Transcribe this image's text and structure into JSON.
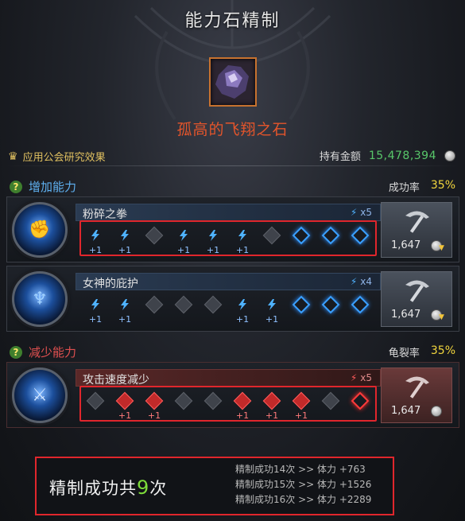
{
  "title": "能力石精制",
  "stone": {
    "name": "孤高的飞翔之石",
    "icon": "amethyst-stone-icon"
  },
  "guild": {
    "label": "应用公会研究效果"
  },
  "gold": {
    "label": "持有金额",
    "value": "15,478,394"
  },
  "increase": {
    "header": "增加能力",
    "rate_label": "成功率",
    "rate_value": "35%",
    "abilities": [
      {
        "name": "粉碎之拳",
        "mult": "x5",
        "slots": [
          {
            "state": "hit",
            "plus": "+1"
          },
          {
            "state": "hit",
            "plus": "+1"
          },
          {
            "state": "fail",
            "plus": ""
          },
          {
            "state": "hit",
            "plus": "+1"
          },
          {
            "state": "hit",
            "plus": "+1"
          },
          {
            "state": "hit",
            "plus": "+1"
          },
          {
            "state": "fail",
            "plus": ""
          },
          {
            "state": "empty",
            "plus": ""
          },
          {
            "state": "empty",
            "plus": ""
          },
          {
            "state": "empty",
            "plus": ""
          }
        ],
        "cost": "1,647"
      },
      {
        "name": "女神的庇护",
        "mult": "x4",
        "slots": [
          {
            "state": "hit",
            "plus": "+1"
          },
          {
            "state": "hit",
            "plus": "+1"
          },
          {
            "state": "fail",
            "plus": ""
          },
          {
            "state": "fail",
            "plus": ""
          },
          {
            "state": "fail",
            "plus": ""
          },
          {
            "state": "hit",
            "plus": "+1"
          },
          {
            "state": "hit",
            "plus": "+1"
          },
          {
            "state": "empty",
            "plus": ""
          },
          {
            "state": "empty",
            "plus": ""
          },
          {
            "state": "empty",
            "plus": ""
          }
        ],
        "cost": "1,647"
      }
    ]
  },
  "decrease": {
    "header": "减少能力",
    "rate_label": "龟裂率",
    "rate_value": "35%",
    "ability": {
      "name": "攻击速度减少",
      "mult": "x5",
      "slots": [
        {
          "state": "fail",
          "plus": ""
        },
        {
          "state": "hit",
          "plus": "+1"
        },
        {
          "state": "hit",
          "plus": "+1"
        },
        {
          "state": "fail",
          "plus": ""
        },
        {
          "state": "fail",
          "plus": ""
        },
        {
          "state": "hit",
          "plus": "+1"
        },
        {
          "state": "hit",
          "plus": "+1"
        },
        {
          "state": "hit",
          "plus": "+1"
        },
        {
          "state": "fail",
          "plus": ""
        },
        {
          "state": "empty",
          "plus": ""
        }
      ],
      "cost": "1,647"
    }
  },
  "result": {
    "prefix": "精制成功共",
    "count": "9",
    "suffix": "次",
    "lines": [
      "精制成功14次 >> 体力 +763",
      "精制成功15次 >> 体力 +1526",
      "精制成功16次 >> 体力 +2289"
    ]
  },
  "colors": {
    "accent_blue": "#4fb3ff",
    "accent_red": "#e0262c",
    "rate_yellow": "#f2d63d",
    "gold_green": "#58c76a",
    "stone_name": "#e4552b"
  }
}
